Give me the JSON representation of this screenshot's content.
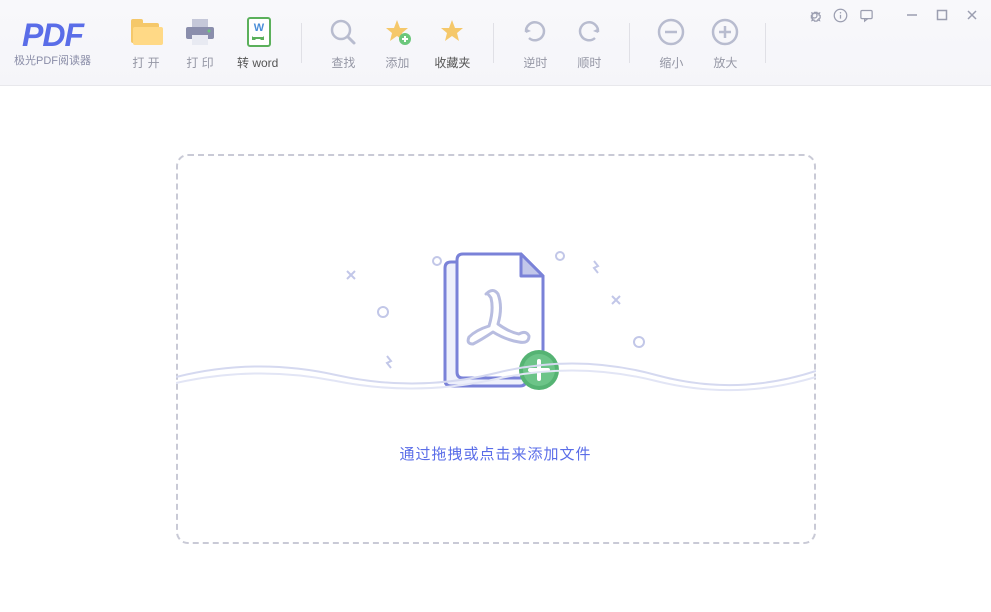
{
  "app": {
    "logo": "PDF",
    "name": "极光PDF阅读器"
  },
  "toolbar": {
    "groups": [
      {
        "items": [
          {
            "id": "open",
            "label": "打 开",
            "icon": "folder"
          },
          {
            "id": "print",
            "label": "打 印",
            "icon": "printer"
          },
          {
            "id": "toword",
            "label": "转 word",
            "icon": "word",
            "active": true
          }
        ]
      },
      {
        "items": [
          {
            "id": "find",
            "label": "查找",
            "icon": "search"
          },
          {
            "id": "add",
            "label": "添加",
            "icon": "star-add"
          },
          {
            "id": "fav",
            "label": "收藏夹",
            "icon": "star",
            "active": true
          }
        ]
      },
      {
        "items": [
          {
            "id": "ccw",
            "label": "逆时",
            "icon": "rotate-ccw"
          },
          {
            "id": "cw",
            "label": "顺时",
            "icon": "rotate-cw"
          }
        ]
      },
      {
        "items": [
          {
            "id": "zoomout",
            "label": "缩小",
            "icon": "minus"
          },
          {
            "id": "zoomin",
            "label": "放大",
            "icon": "plus"
          }
        ]
      }
    ]
  },
  "dropzone": {
    "text": "通过拖拽或点击来添加文件"
  },
  "windowControls": {
    "settings": "gear-icon",
    "info": "info-icon",
    "feedback": "feedback-icon",
    "minimize": "minimize-icon",
    "maximize": "maximize-icon",
    "close": "close-icon"
  },
  "icons": {
    "folder": "folder",
    "printer": "printer",
    "word": "word",
    "search": "search",
    "star-add": "star-add",
    "star": "star",
    "rotate-ccw": "rotate-ccw",
    "rotate-cw": "rotate-cw",
    "minus": "minus",
    "plus": "plus"
  }
}
